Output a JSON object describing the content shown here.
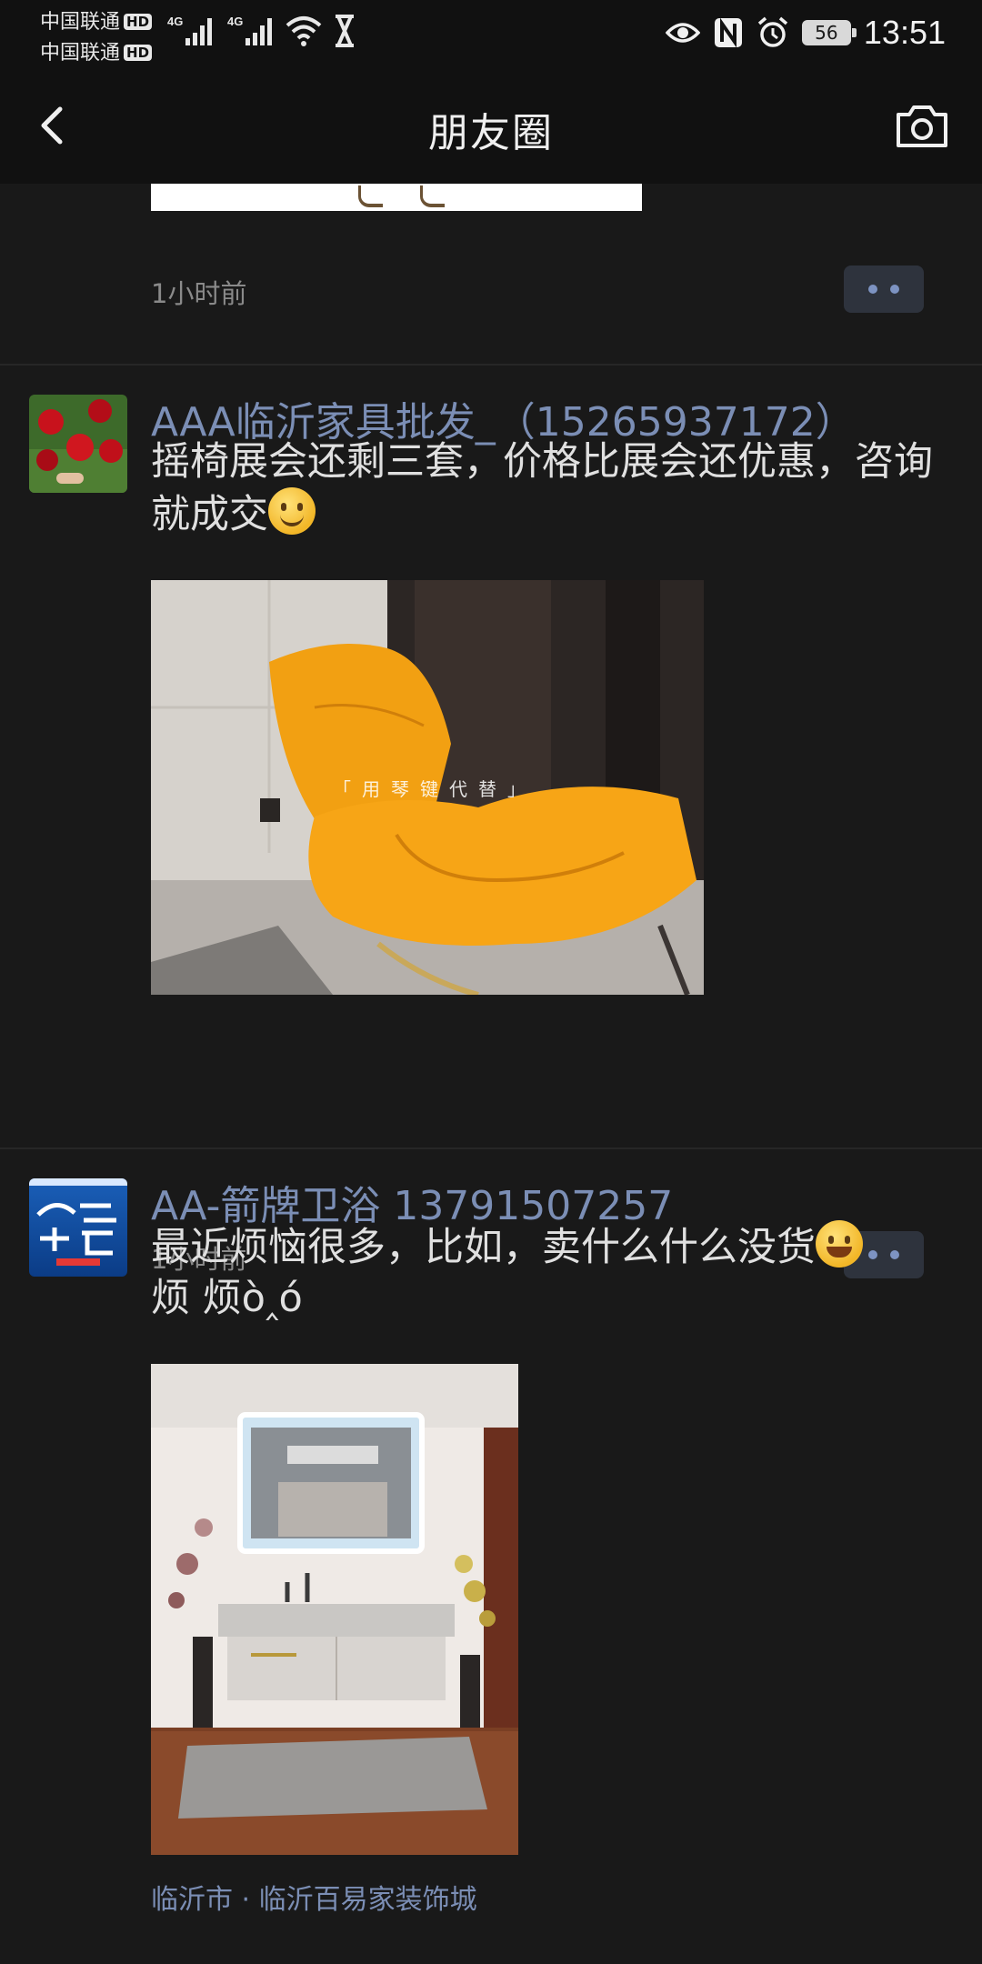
{
  "status_bar": {
    "carrier_1": "中国联通",
    "carrier_2": "中国联通",
    "hd_badge": "HD",
    "network_1": "4G",
    "network_2": "4G",
    "battery": "56",
    "time": "13:51"
  },
  "nav": {
    "title": "朋友圈",
    "back_icon": "chevron-left-icon",
    "camera_icon": "camera-icon"
  },
  "feed": {
    "first_post_time": "1小时前",
    "posts": [
      {
        "name": "AAA临沂家具批发_（15265937172）",
        "text": "摇椅展会还剩三套，价格比展会还优惠，咨询就成交",
        "emoji": "smile-emoji",
        "image_watermark": "「用琴键代替」",
        "time": "1小时前"
      },
      {
        "name": "AA-箭牌卫浴 13791507257",
        "text": "最近烦恼很多，比如，卖什么什么没货",
        "emoji": "laughing-tears-emoji",
        "text_tail": "烦 烦ò‸ó",
        "location": "临沂市 · 临沂百易家装饰城"
      }
    ]
  },
  "colors": {
    "background": "#191919",
    "bar_background": "#111111",
    "name_link": "#7b8eb5",
    "time_gray": "#8a8a8a",
    "more_button": "#2e333d"
  }
}
